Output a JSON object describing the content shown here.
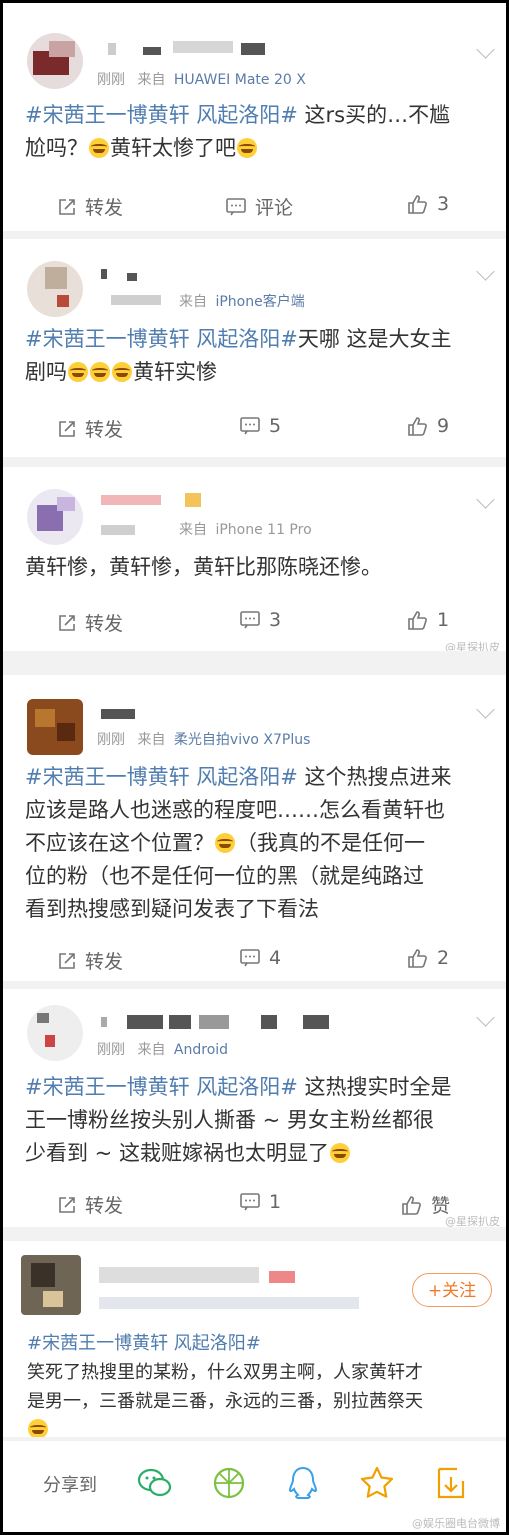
{
  "posts": [
    {
      "meta_time": "刚刚",
      "meta_from": "来自",
      "meta_source": "HUAWEI Mate 20 X",
      "topic": "#宋茜王一博黄轩 风起洛阳#",
      "text_a": " 这rs买的…不尴",
      "text_b": "尬吗？",
      "text_c": "黄轩太惨了吧",
      "repost": "转发",
      "comment": "评论",
      "likes": "3"
    },
    {
      "meta_from": "来自",
      "meta_source": "iPhone客户端",
      "topic": "#宋茜王一博黄轩 风起洛阳#",
      "text_a": "天哪 这是大女主",
      "text_b": "剧吗",
      "text_c": "黄轩实惨",
      "repost": "转发",
      "comments": "5",
      "likes": "9"
    },
    {
      "meta_from": "来自",
      "meta_source": "iPhone 11 Pro",
      "text": "黄轩惨，黄轩惨，黄轩比那陈晓还惨。",
      "repost": "转发",
      "comments": "3",
      "likes": "1",
      "watermark": "@星探扒皮"
    },
    {
      "meta_time": "刚刚",
      "meta_from": "来自",
      "meta_source": "柔光自拍vivo X7Plus",
      "topic": "#宋茜王一博黄轩 风起洛阳#",
      "line1": " 这个热搜点进来",
      "line2": "应该是路人也迷惑的程度吧……怎么看黄轩也",
      "line3a": "不应该在这个位置？",
      "line3b": "（我真的不是任何一",
      "line4": "位的粉（也不是任何一位的黑（就是纯路过",
      "line5": "看到热搜感到疑问发表了下看法",
      "repost": "转发",
      "comments": "4",
      "likes": "2"
    },
    {
      "meta_time": "刚刚",
      "meta_from": "来自",
      "meta_source": "Android",
      "topic": "#宋茜王一博黄轩 风起洛阳#",
      "line1": " 这热搜实时全是",
      "line2": "王一博粉丝按头别人撕番 ~ 男女主粉丝都很",
      "line3": "少看到 ~ 这栽赃嫁祸也太明显了",
      "repost": "转发",
      "comments": "1",
      "likes": "赞",
      "watermark": "@星探扒皮"
    },
    {
      "follow": "+关注",
      "topic": "#宋茜王一博黄轩 风起洛阳#",
      "line1": "笑死了热搜里的某粉，什么双男主啊，人家黄轩才",
      "line2": "是男一，三番就是三番，永远的三番，别拉茜祭天"
    }
  ],
  "share": {
    "label": "分享到",
    "icons": [
      "wechat-icon",
      "moments-icon",
      "qq-icon",
      "favorite-star-icon",
      "download-icon"
    ],
    "watermark": "@娱乐圈电台微博"
  },
  "colors": {
    "topic": "#507daf",
    "source": "#5b7ca8",
    "follow": "#f07a2a"
  }
}
